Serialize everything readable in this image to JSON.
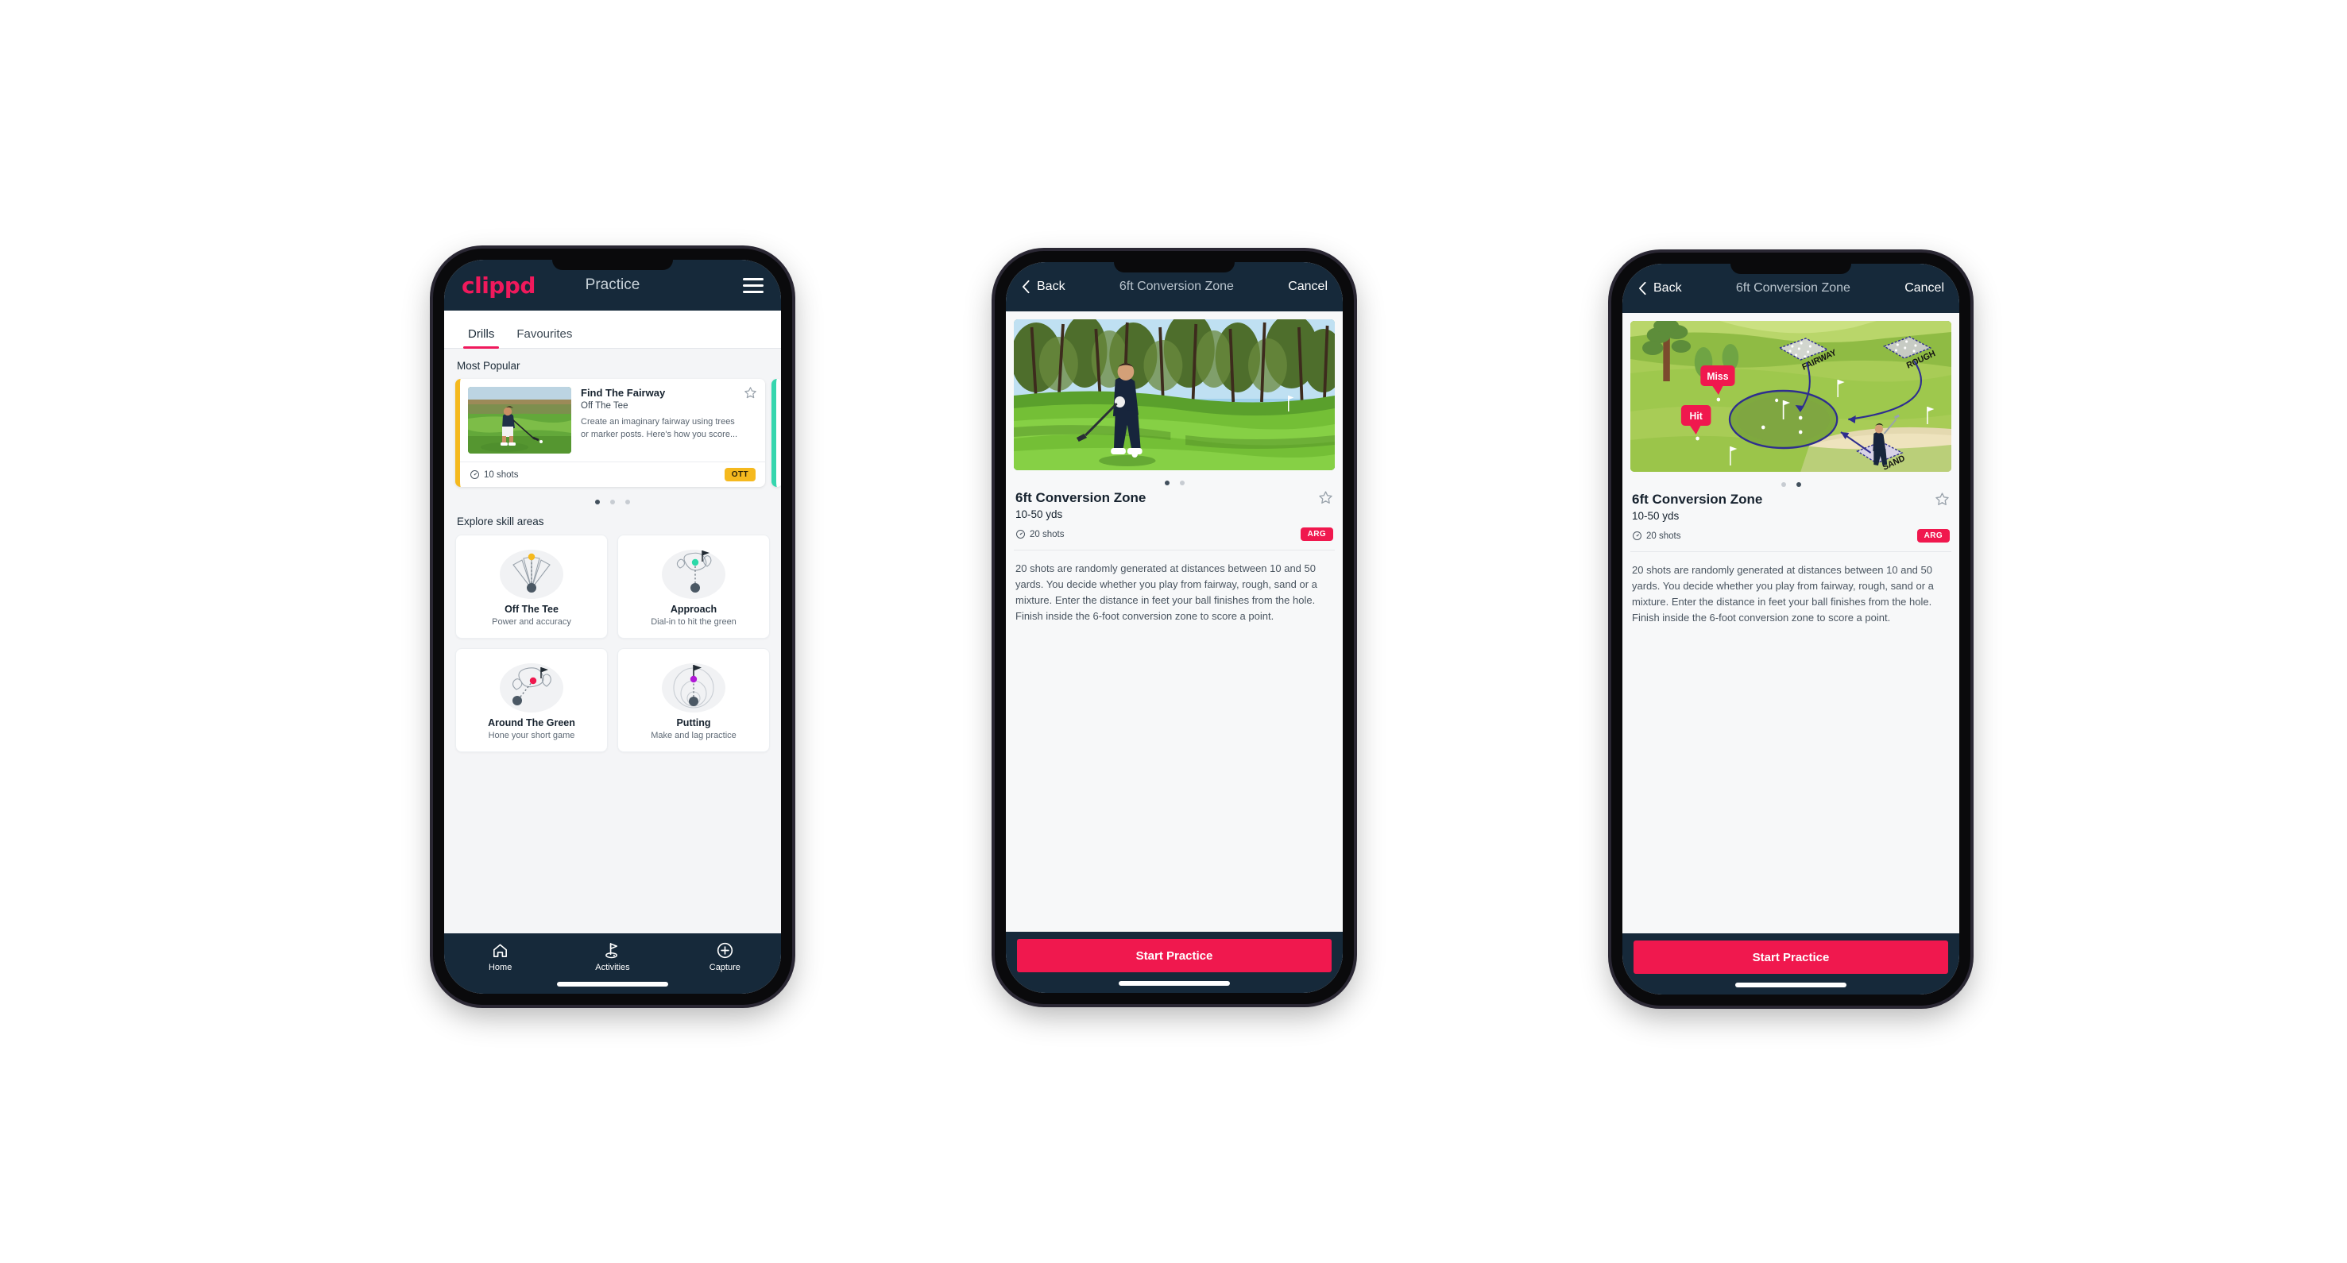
{
  "phone1": {
    "appbar": {
      "brand": "clippd",
      "title": "Practice",
      "menu_icon": "hamburger-icon"
    },
    "tabs": [
      {
        "label": "Drills",
        "active": true
      },
      {
        "label": "Favourites",
        "active": false
      }
    ],
    "sections": {
      "most_popular": "Most Popular",
      "explore": "Explore skill areas"
    },
    "drill_card": {
      "title": "Find The Fairway",
      "subtitle": "Off The Tee",
      "description": "Create an imaginary fairway using trees or marker posts. Here's how you score...",
      "shots": "10 shots",
      "badge": "OTT",
      "badge_color": "#f5b91e",
      "accent_color": "#f5b91e",
      "star_icon": "star-outline-icon",
      "clock_icon": "clock-icon"
    },
    "peek_accent_color": "#36d6ae",
    "carousel_dots": {
      "count": 3,
      "active": 0
    },
    "skills": [
      {
        "name": "Off The Tee",
        "desc": "Power and accuracy",
        "icon": "off-the-tee-icon",
        "accent": "#f5b91e"
      },
      {
        "name": "Approach",
        "desc": "Dial-in to hit the green",
        "icon": "approach-icon",
        "accent": "#2bd9a8"
      },
      {
        "name": "Around The Green",
        "desc": "Hone your short game",
        "icon": "around-the-green-icon",
        "accent": "#f0184e"
      },
      {
        "name": "Putting",
        "desc": "Make and lag practice",
        "icon": "putting-icon",
        "accent": "#b019d6"
      }
    ],
    "tabbar": [
      {
        "label": "Home",
        "icon": "home-icon",
        "active": false
      },
      {
        "label": "Activities",
        "icon": "golf-flag-icon",
        "active": true
      },
      {
        "label": "Capture",
        "icon": "plus-circle-icon",
        "active": false
      }
    ]
  },
  "phone2": {
    "navbar": {
      "back": "Back",
      "title": "6ft Conversion Zone",
      "cancel": "Cancel",
      "back_icon": "chevron-left-icon"
    },
    "media": {
      "type": "photo",
      "alt": "golfer-chipping-on-course"
    },
    "dots": {
      "count": 2,
      "active": 0
    },
    "detail": {
      "title": "6ft Conversion Zone",
      "distance": "10-50 yds",
      "shots": "20 shots",
      "badge": "ARG",
      "badge_color": "#f0184e",
      "star_icon": "star-outline-icon",
      "clock_icon": "clock-icon",
      "description": "20 shots are randomly generated at distances between 10 and 50 yards. You decide whether you play from fairway, rough, sand or a mixture. Enter the distance in feet your ball finishes from the hole. Finish inside the 6-foot conversion zone to score a point."
    },
    "cta": "Start Practice",
    "cta_color": "#f0184e"
  },
  "phone3": {
    "navbar": {
      "back": "Back",
      "title": "6ft Conversion Zone",
      "cancel": "Cancel",
      "back_icon": "chevron-left-icon"
    },
    "media": {
      "type": "illustration",
      "alt": "golf-hole-diagram",
      "labels": {
        "fairway": "FAIRWAY",
        "rough": "ROUGH",
        "sand": "SAND"
      },
      "markers": {
        "miss": "Miss",
        "hit": "Hit"
      },
      "marker_color": "#f0184e"
    },
    "dots": {
      "count": 2,
      "active": 1
    },
    "detail": {
      "title": "6ft Conversion Zone",
      "distance": "10-50 yds",
      "shots": "20 shots",
      "badge": "ARG",
      "badge_color": "#f0184e",
      "star_icon": "star-outline-icon",
      "clock_icon": "clock-icon",
      "description": "20 shots are randomly generated at distances between 10 and 50 yards. You decide whether you play from fairway, rough, sand or a mixture. Enter the distance in feet your ball finishes from the hole. Finish inside the 6-foot conversion zone to score a point."
    },
    "cta": "Start Practice",
    "cta_color": "#f0184e"
  }
}
